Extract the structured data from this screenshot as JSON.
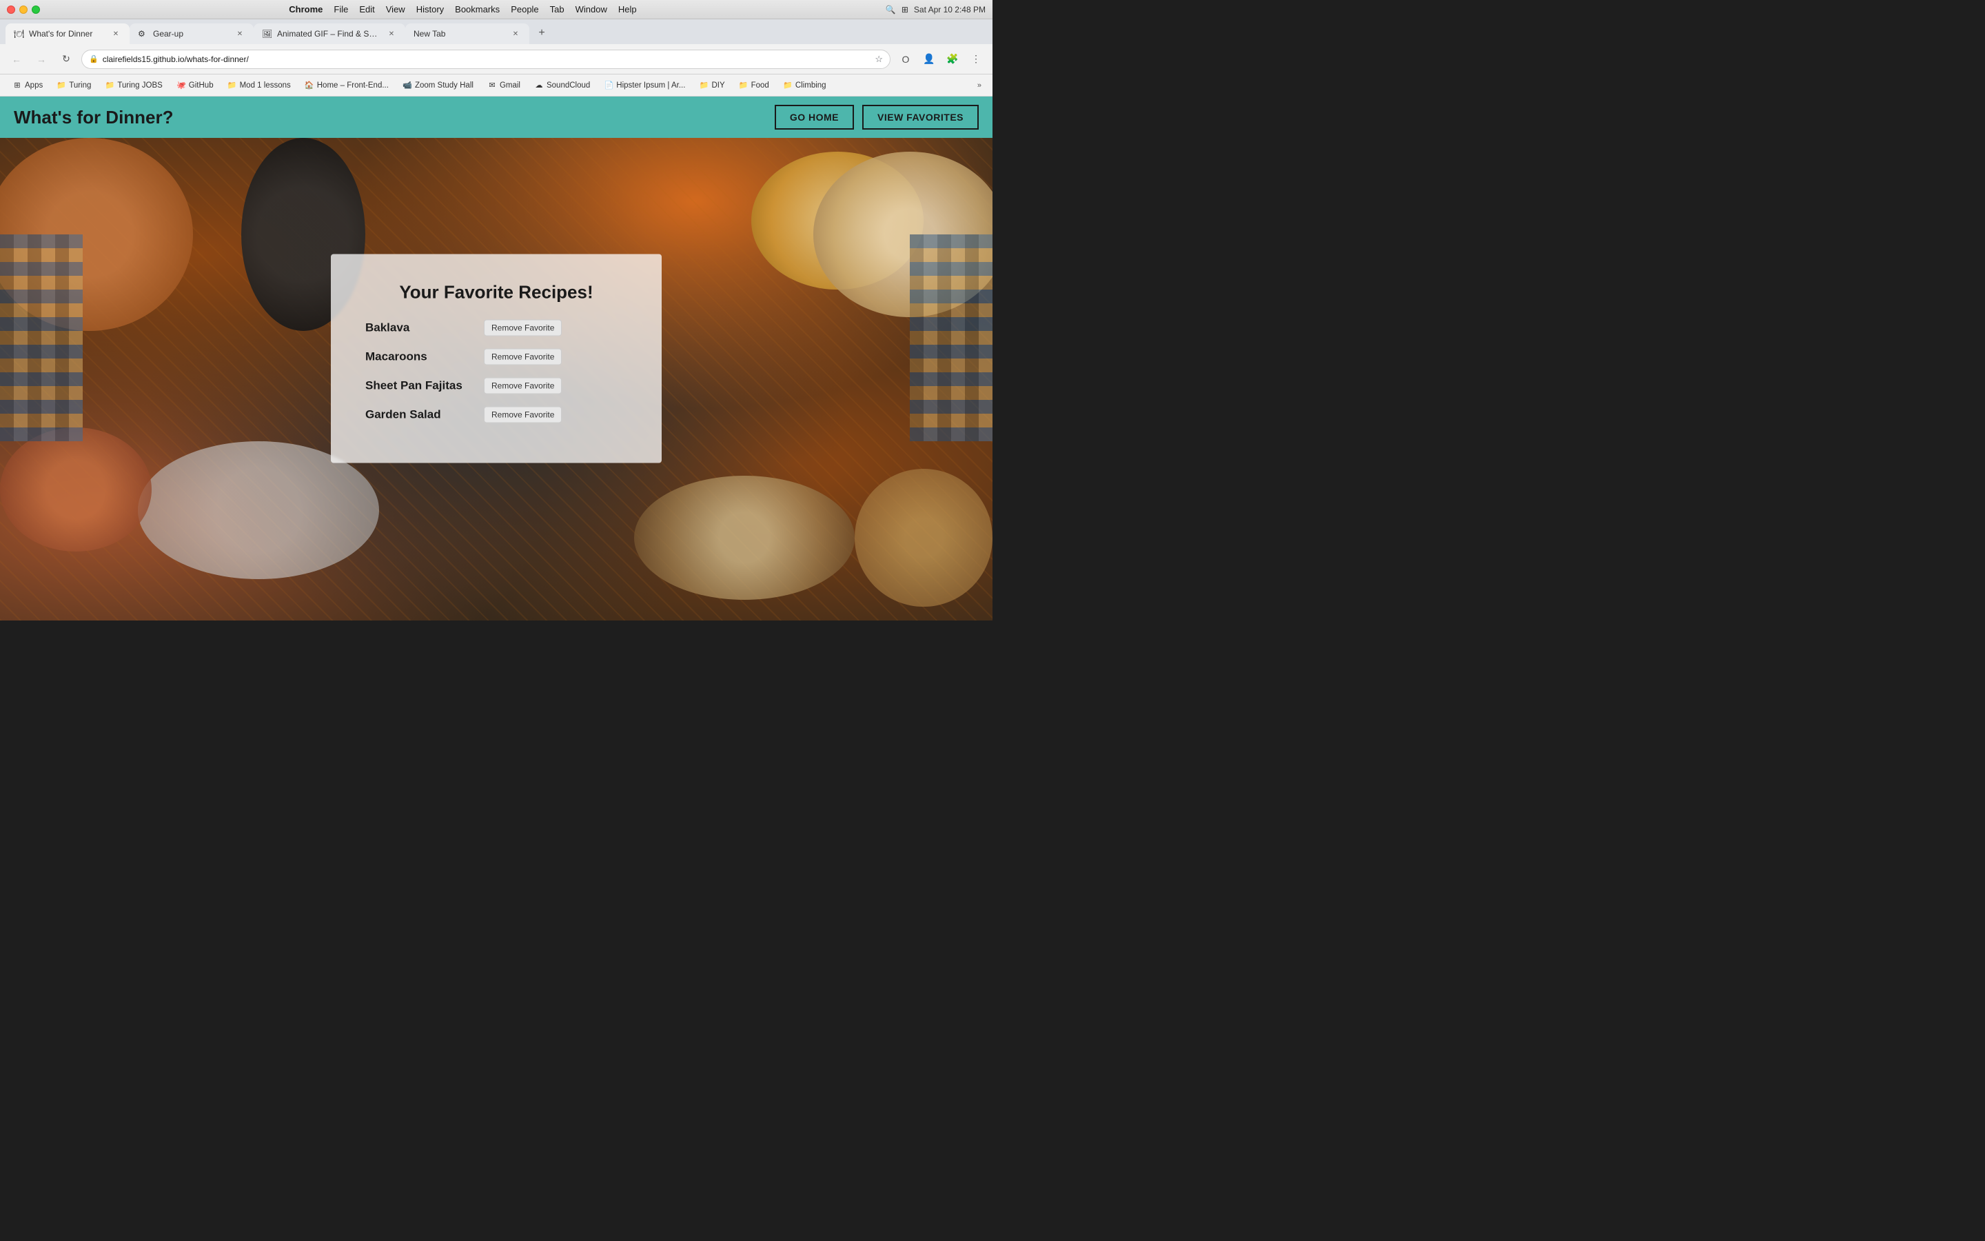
{
  "os": {
    "time": "Sat Apr 10  2:48 PM"
  },
  "titlebar": {
    "menu_items": [
      "Chrome",
      "File",
      "Edit",
      "View",
      "History",
      "Bookmarks",
      "People",
      "Tab",
      "Window",
      "Help"
    ]
  },
  "tabs": [
    {
      "id": "tab1",
      "title": "What's for Dinner",
      "active": true,
      "favicon": "🍽"
    },
    {
      "id": "tab2",
      "title": "Gear-up",
      "active": false,
      "favicon": "⚙"
    },
    {
      "id": "tab3",
      "title": "Animated GIF – Find & Share Or...",
      "active": false,
      "favicon": "🖼"
    },
    {
      "id": "tab4",
      "title": "New Tab",
      "active": false,
      "favicon": ""
    }
  ],
  "toolbar": {
    "url": "clairefields15.github.io/whats-for-dinner/"
  },
  "bookmarks": [
    {
      "label": "Apps",
      "icon": "⊞"
    },
    {
      "label": "Turing",
      "icon": "📁"
    },
    {
      "label": "Turing JOBS",
      "icon": "📁"
    },
    {
      "label": "GitHub",
      "icon": "🐙"
    },
    {
      "label": "Mod 1 lessons",
      "icon": "📁"
    },
    {
      "label": "Home – Front-End...",
      "icon": "🏠"
    },
    {
      "label": "Zoom Study Hall",
      "icon": "📹"
    },
    {
      "label": "Gmail",
      "icon": "✉"
    },
    {
      "label": "SoundCloud",
      "icon": "☁"
    },
    {
      "label": "Hipster Ipsum | Ar...",
      "icon": "📄"
    },
    {
      "label": "DIY",
      "icon": "📁"
    },
    {
      "label": "Food",
      "icon": "📁"
    },
    {
      "label": "Climbing",
      "icon": "📁"
    }
  ],
  "app": {
    "title": "What's for Dinner?",
    "go_home_label": "GO HOME",
    "view_favorites_label": "VIEW FAVORITES",
    "header_bg_color": "#4db6ac"
  },
  "favorites": {
    "title": "Your Favorite Recipes!",
    "recipes": [
      {
        "name": "Baklava",
        "remove_label": "Remove Favorite"
      },
      {
        "name": "Macaroons",
        "remove_label": "Remove Favorite"
      },
      {
        "name": "Sheet Pan Fajitas",
        "remove_label": "Remove Favorite"
      },
      {
        "name": "Garden Salad",
        "remove_label": "Remove Favorite"
      }
    ]
  }
}
